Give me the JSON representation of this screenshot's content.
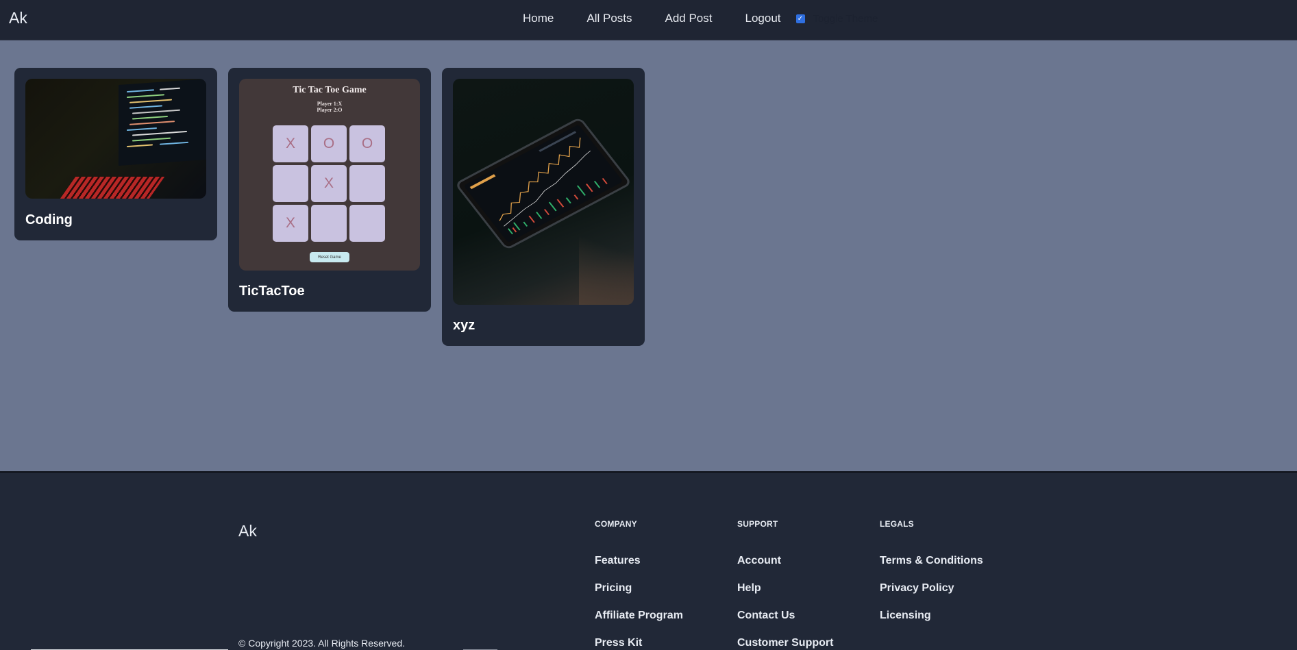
{
  "navbar": {
    "brand": "Ak",
    "links": [
      "Home",
      "All Posts",
      "Add Post",
      "Logout"
    ],
    "theme_toggle_label": "Toggle Theme",
    "theme_toggle_checked": true
  },
  "posts": [
    {
      "title": "Coding"
    },
    {
      "title": "TicTacToe"
    },
    {
      "title": "xyz"
    }
  ],
  "tictactoe_preview": {
    "title": "Tic Tac Toe Game",
    "player1": "Player 1:X",
    "player2": "Player 2:O",
    "cells": [
      "X",
      "O",
      "O",
      "",
      "X",
      "",
      "X",
      "",
      ""
    ],
    "reset_label": "Reset Game"
  },
  "footer": {
    "brand": "Ak",
    "copyright": "© Copyright 2023. All Rights Reserved.",
    "columns": [
      {
        "heading": "COMPANY",
        "links": [
          "Features",
          "Pricing",
          "Affiliate Program",
          "Press Kit"
        ]
      },
      {
        "heading": "SUPPORT",
        "links": [
          "Account",
          "Help",
          "Contact Us",
          "Customer Support"
        ]
      },
      {
        "heading": "LEGALS",
        "links": [
          "Terms & Conditions",
          "Privacy Policy",
          "Licensing"
        ]
      }
    ]
  },
  "colors": {
    "page_bg": "#6b7690",
    "navbar_bg": "#1f2533",
    "card_bg": "#212837",
    "footer_bg": "#212837",
    "toggle_accent": "#2f6fe0"
  }
}
